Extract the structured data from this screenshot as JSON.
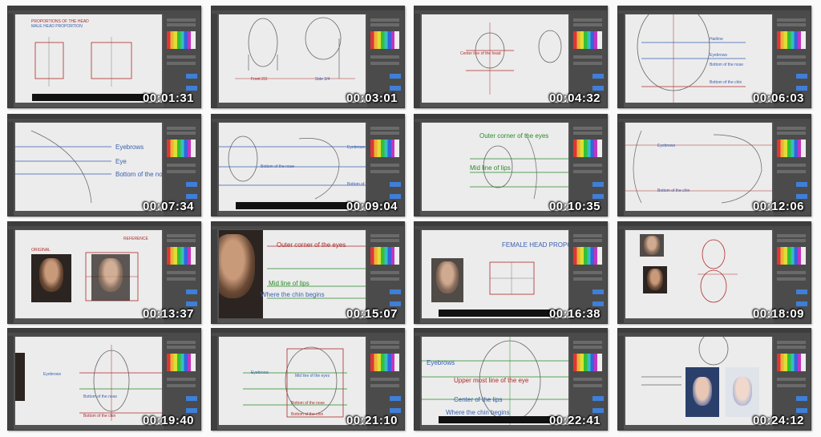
{
  "thumbnails": [
    {
      "time": "00:01:31",
      "labels": [
        "PROPORTIONS OF THE HEAD",
        "MALE HEAD PROPORTION"
      ]
    },
    {
      "time": "00:03:01",
      "labels": [
        "Front  2/3",
        "Side  3/4"
      ]
    },
    {
      "time": "00:04:32",
      "labels": [
        "Center line of the head"
      ]
    },
    {
      "time": "00:06:03",
      "labels": [
        "Hairline",
        "Eyebrows",
        "Bottom of the nose",
        "Bottom of the chin"
      ]
    },
    {
      "time": "00:07:34",
      "labels": [
        "Eyebrows",
        "Eye",
        "Bottom of the nose"
      ]
    },
    {
      "time": "00:09:04",
      "labels": [
        "Eyebrows",
        "Bottom of the nose",
        "Bottom of the chin"
      ]
    },
    {
      "time": "00:10:35",
      "labels": [
        "Outer corner of the eyes",
        "Mid line of lips"
      ]
    },
    {
      "time": "00:12:06",
      "labels": [
        "Eyebrows",
        "Bottom of the chin"
      ]
    },
    {
      "time": "00:13:37",
      "labels": [
        "ORIGINAL",
        "REFERENCE"
      ]
    },
    {
      "time": "00:15:07",
      "labels": [
        "Outer corner of the eyes",
        "Mid line of lips",
        "Where the chin begins"
      ]
    },
    {
      "time": "00:16:38",
      "labels": [
        "FEMALE HEAD PROPORTION"
      ]
    },
    {
      "time": "00:18:09",
      "labels": []
    },
    {
      "time": "00:19:40",
      "labels": [
        "Eyebrows",
        "Bottom of the nose",
        "Bottom of the chin"
      ]
    },
    {
      "time": "00:21:10",
      "labels": [
        "Eyebrows",
        "Mid line of the eyes",
        "Bottom of the nose",
        "Bottom of the chin"
      ]
    },
    {
      "time": "00:22:41",
      "labels": [
        "Eyebrows",
        "Upper most line of the eye",
        "Center of the lips",
        "Where the chin begins"
      ]
    },
    {
      "time": "00:24:12",
      "labels": []
    }
  ],
  "colors": {
    "ui_dark": "#535353",
    "canvas": "#ececec",
    "guide_red": "#b02a2a",
    "guide_blue": "#3a5fb0",
    "guide_green": "#2a8a2a"
  }
}
